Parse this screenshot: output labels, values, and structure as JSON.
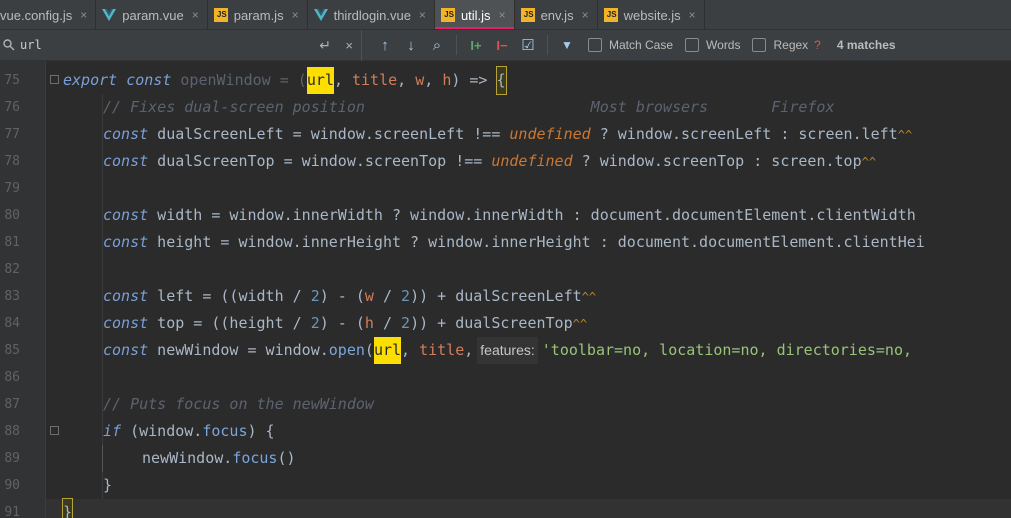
{
  "tabs": [
    {
      "label": "vue.config.js",
      "type": "js",
      "active": false
    },
    {
      "label": "param.vue",
      "type": "vue",
      "active": false
    },
    {
      "label": "param.js",
      "type": "js",
      "active": false
    },
    {
      "label": "thirdlogin.vue",
      "type": "vue",
      "active": false
    },
    {
      "label": "util.js",
      "type": "js",
      "active": true
    },
    {
      "label": "env.js",
      "type": "js",
      "active": false
    },
    {
      "label": "website.js",
      "type": "js",
      "active": false
    }
  ],
  "js_icon_text": "JS",
  "close_glyph": "×",
  "find": {
    "query": "url",
    "enter_glyph": "↵",
    "close_glyph": "×",
    "match_case_label": "Match Case",
    "words_label": "Words",
    "regex_label": "Regex",
    "help_glyph": "?",
    "matches_label": "4 matches",
    "prev_glyph": "↑",
    "next_glyph": "↓",
    "find_in_file_glyph": "⌕",
    "add_sel_glyph": "I+",
    "remove_sel_glyph": "I−",
    "select_all_glyph": "☑",
    "filter_glyph": "▼"
  },
  "gutter": {
    "line_numbers": [
      "75",
      "76",
      "77",
      "78",
      "79",
      "80",
      "81",
      "82",
      "83",
      "84",
      "85",
      "86",
      "87",
      "88",
      "89",
      "90",
      "91"
    ]
  },
  "code": {
    "l75": {
      "export": "export",
      "const": "const",
      "name": "openWindow",
      "eq": " = (",
      "url": "url",
      "rest": ", ",
      "title": "title",
      "c1": ", ",
      "w": "w",
      "c2": ", ",
      "h": "h",
      "arrow": ") => ",
      "brace": "{"
    },
    "l76": {
      "comment": "// Fixes dual-screen position                         Most browsers       Firefox"
    },
    "l77": {
      "const": "const",
      "a": " dualScreenLeft = window.screenLeft !== ",
      "undef": "undefined",
      "b": " ? window.screenLeft : screen.left",
      "wave": "^^"
    },
    "l78": {
      "const": "const",
      "a": " dualScreenTop = window.screenTop !== ",
      "undef": "undefined",
      "b": " ? window.screenTop : screen.top",
      "wave": "^^"
    },
    "l80": {
      "const": "const",
      "a": " width = window.innerWidth ? window.innerWidth : document.documentElement.clientWidth"
    },
    "l81": {
      "const": "const",
      "a": " height = window.innerHeight ? window.innerHeight : document.documentElement.clientHei"
    },
    "l83": {
      "const": "const",
      "a": " left = ((width / ",
      "n1": "2",
      "b": ") - (",
      "w": "w",
      "c": " / ",
      "n2": "2",
      "d": ")) + dualScreenLeft",
      "wave": "^^"
    },
    "l84": {
      "const": "const",
      "a": " top = ((height / ",
      "n1": "2",
      "b": ") - (",
      "h": "h",
      "c": " / ",
      "n2": "2",
      "d": ")) + dualScreenTop",
      "wave": "^^"
    },
    "l85": {
      "const": "const",
      "a": " newWindow = window.",
      "open": "open",
      "p": "(",
      "url": "url",
      "b": ", ",
      "title": "title",
      "c": ",",
      "hint": "features:",
      "str": "'toolbar=no, location=no, directories=no,"
    },
    "l87": {
      "comment": "// Puts focus on the newWindow"
    },
    "l88": {
      "if": "if",
      "a": " (window.",
      "focus": "focus",
      "b": ") {"
    },
    "l89": {
      "a": "newWindow.",
      "focus": "focus",
      "b": "()"
    },
    "l90": {
      "brace": "}"
    },
    "l91": {
      "brace": "}"
    }
  }
}
